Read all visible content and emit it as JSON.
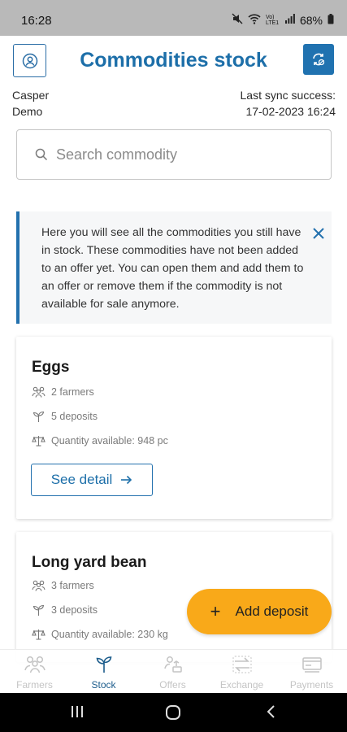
{
  "status_bar": {
    "time": "16:28",
    "battery": "68%",
    "mute_icon": "mute-icon",
    "wifi_icon": "wifi-icon",
    "signal_text": "Vo) LTE1",
    "signal_icon": "signal-icon",
    "battery_icon": "battery-icon"
  },
  "header": {
    "title": "Commodities stock",
    "profile_icon": "user-circle-icon",
    "sync_icon": "sync-icon"
  },
  "user": {
    "first_name": "Casper",
    "last_name": "Demo"
  },
  "sync": {
    "label": "Last sync success:",
    "timestamp": "17-02-2023 16:24"
  },
  "search": {
    "placeholder": "Search commodity",
    "value": ""
  },
  "info_banner": {
    "text": "Here you will see all the commodities you still have in stock. These commodities have not been added to an offer yet. You can open them and add them to an offer or remove them if the commodity is not available for sale anymore."
  },
  "commodities": [
    {
      "name": "Eggs",
      "farmers": "2 farmers",
      "deposits": "5 deposits",
      "quantity": "Quantity available: 948 pc",
      "detail_label": "See detail"
    },
    {
      "name": "Long yard bean",
      "farmers": "3 farmers",
      "deposits": "3 deposits",
      "quantity": "Quantity available: 230 kg"
    }
  ],
  "fab": {
    "label": "Add deposit"
  },
  "bottom_nav": [
    {
      "label": "Farmers",
      "icon": "farmers-icon",
      "active": false
    },
    {
      "label": "Stock",
      "icon": "sprout-icon",
      "active": true
    },
    {
      "label": "Offers",
      "icon": "offers-icon",
      "active": false
    },
    {
      "label": "Exchange",
      "icon": "exchange-icon",
      "active": false
    },
    {
      "label": "Payments",
      "icon": "payments-icon",
      "active": false
    }
  ],
  "colors": {
    "primary": "#1d6fa9",
    "accent": "#f9a919",
    "status_bar": "#b9b9b9"
  }
}
